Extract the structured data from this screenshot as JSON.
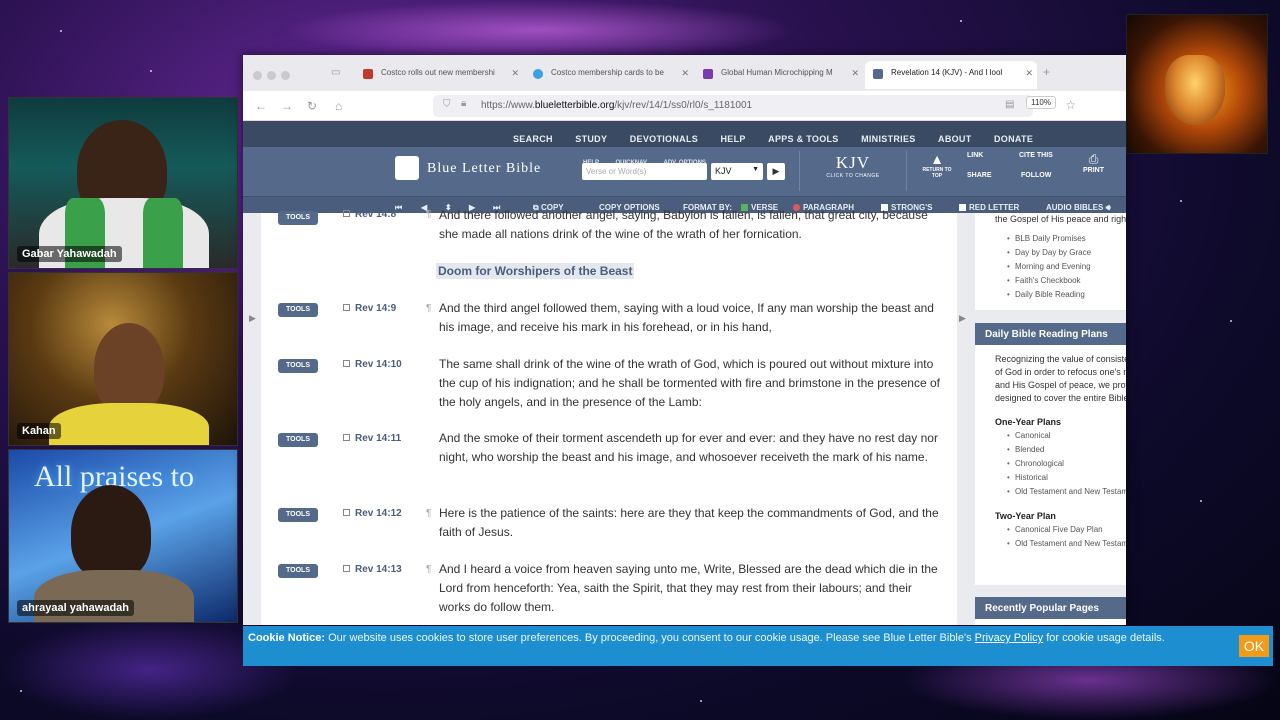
{
  "participants": [
    {
      "name": "Gabar Yahawadah"
    },
    {
      "name": "Kahan"
    },
    {
      "name": "ahrayaal yahawadah",
      "banner": "All praises to"
    }
  ],
  "browser": {
    "tabs": [
      {
        "label": "Costco rolls out new membershi",
        "color": "#c0392b"
      },
      {
        "label": "Costco membership cards to be",
        "color": "#3aa0e0"
      },
      {
        "label": "Global Human Microchipping M",
        "color": "#7a3ab0"
      },
      {
        "label": "Revelation 14 (KJV) - And I lool",
        "color": "#55698a"
      }
    ],
    "url_prefix": "https://www.",
    "url_domain": "blueletterbible.org",
    "url_path": "/kjv/rev/14/1/ss0/rl0/s_1181001",
    "zoom": "110%"
  },
  "blb": {
    "menu": [
      "SEARCH",
      "STUDY",
      "DEVOTIONALS",
      "HELP",
      "APPS & TOOLS",
      "MINISTRIES",
      "ABOUT",
      "DONATE"
    ],
    "logo": "Blue Letter Bible",
    "mini_links": [
      "HELP",
      "QUICKNAV",
      "ADV. OPTIONS"
    ],
    "search_placeholder": "Verse or Word(s)",
    "version": "KJV",
    "version_big": "KJV",
    "version_small": "CLICK TO CHANGE",
    "return_top": "RETURN TO TOP",
    "links": [
      "LINK",
      "CITE THIS",
      "SHARE",
      "FOLLOW"
    ],
    "print": "PRINT",
    "toolbar": {
      "copy": "COPY",
      "copy_options": "COPY OPTIONS",
      "format_by": "FORMAT BY:",
      "verse": "VERSE",
      "paragraph": "PARAGRAPH",
      "strongs": "STRONG'S",
      "red_letter": "RED LETTER",
      "audio": "AUDIO BIBLES"
    }
  },
  "content": {
    "heading": "Doom for Worshipers of the Beast",
    "tools_label": "TOOLS",
    "verses": [
      {
        "ref": "Rev 14:8",
        "text": "And there followed another angel, saying, Babylon is fallen, is fallen, that great city, because she made all nations drink of the wine of the wrath of her fornication."
      },
      {
        "ref": "Rev 14:9",
        "text": "And the third angel followed them, saying with a loud voice, If any man worship the beast and his image, and receive his mark in his forehead, or in his hand,"
      },
      {
        "ref": "Rev 14:10",
        "text": "The same shall drink of the wine of the wrath of God, which is poured out without mixture into the cup of his indignation; and he shall be tormented with fire and brimstone in the presence of the holy angels, and in the presence of the Lamb:"
      },
      {
        "ref": "Rev 14:11",
        "text": "And the smoke of their torment ascendeth up for ever and ever: and they have no rest day nor night, who worship the beast and his image, and whosoever receiveth the mark of his name."
      },
      {
        "ref": "Rev 14:12",
        "text": "Here is the patience of the saints: here are they that keep the commandments of God, and the faith of Jesus."
      },
      {
        "ref": "Rev 14:13",
        "text": "And I heard a voice from heaven saying unto me, Write, Blessed are the dead which die in the Lord from henceforth: Yea, saith the Spirit, that they may rest from their labours; and their works do follow them."
      }
    ]
  },
  "sidebar": {
    "top_text": "the Gospel of His peace and righteousness.",
    "top_list": [
      "BLB Daily Promises",
      "Day by Day by Grace",
      "Morning and Evening",
      "Faith's Checkbook",
      "Daily Bible Reading"
    ],
    "reading_title": "Daily Bible Reading Plans",
    "reading_text": "Recognizing the value of consistent reflection upon the Word of God in order to refocus one's mind and heart upon Christ and His Gospel of peace, we provide several reading plans designed to cover the entire Bible in a year.",
    "one_year_title": "One-Year Plans",
    "one_year": [
      "Canonical",
      "Blended",
      "Chronological",
      "Historical",
      "Old Testament and New Testament Together"
    ],
    "two_year_title": "Two-Year Plan",
    "two_year": [
      "Canonical Five Day Plan",
      "Old Testament and New Testament Together"
    ],
    "popular_title": "Recently Popular Pages",
    "minimize": "−"
  },
  "cookie": {
    "label": "Cookie Notice:",
    "message": "Our website uses cookies to store user preferences. By proceeding, you consent to our cookie usage. Please see Blue Letter Bible's",
    "link": "Privacy Policy",
    "tail": "for cookie usage details.",
    "ok": "OK"
  }
}
